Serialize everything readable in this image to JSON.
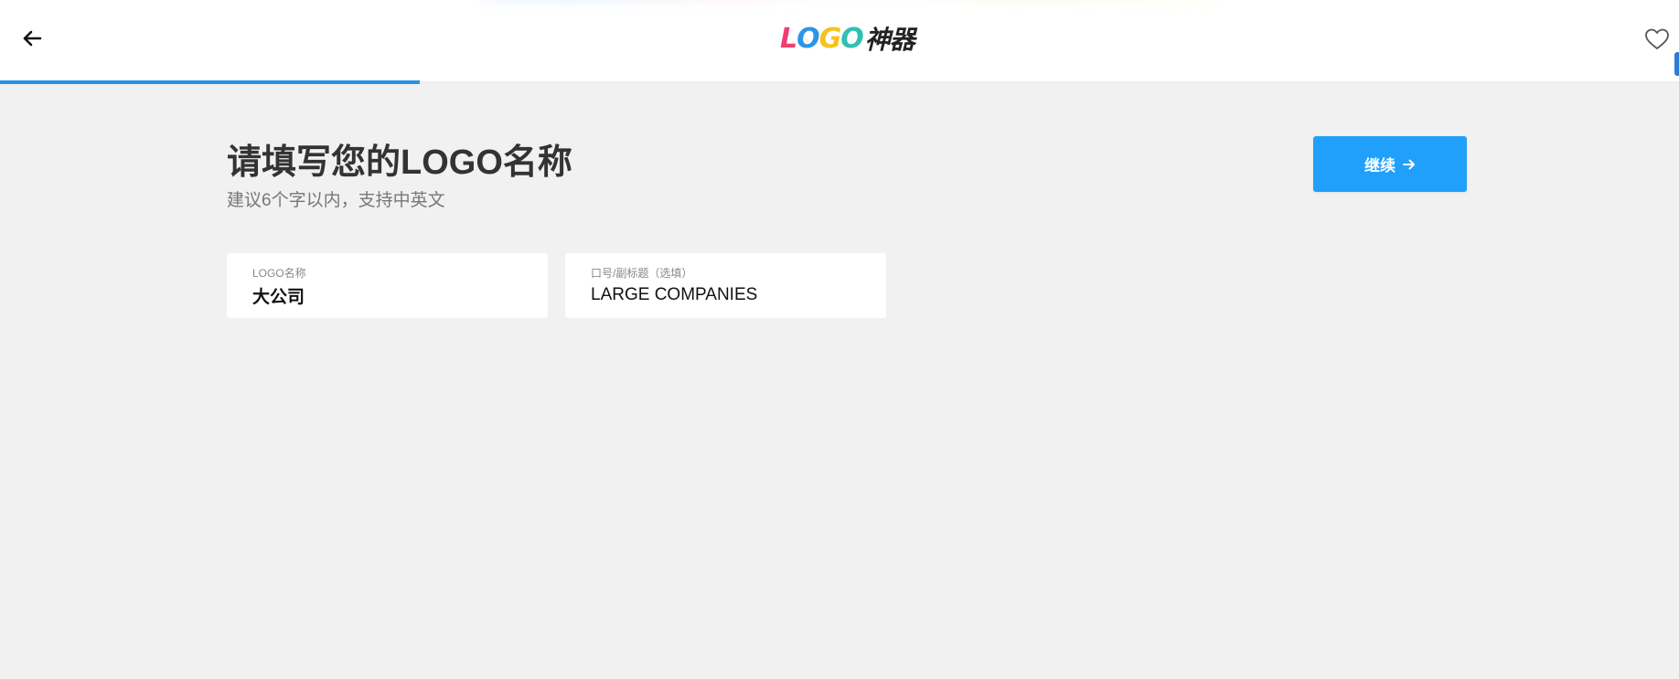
{
  "header": {
    "logo": {
      "l": "L",
      "o": "O",
      "g": "G",
      "o2": "O",
      "cn": "神器"
    },
    "back_icon": "arrow-left-icon",
    "favorite_icon": "heart-icon"
  },
  "progress": {
    "value": 0.25,
    "color": "#2196e8"
  },
  "main": {
    "title": "请填写您的LOGO名称",
    "subtitle": "建议6个字以内，支持中英文",
    "continue_label": "继续",
    "continue_color": "#20a0fb"
  },
  "fields": {
    "name": {
      "label": "LOGO名称",
      "value": "大公司"
    },
    "slogan": {
      "label": "口号/副标题（选填）",
      "value": "LARGE COMPANIES"
    }
  }
}
